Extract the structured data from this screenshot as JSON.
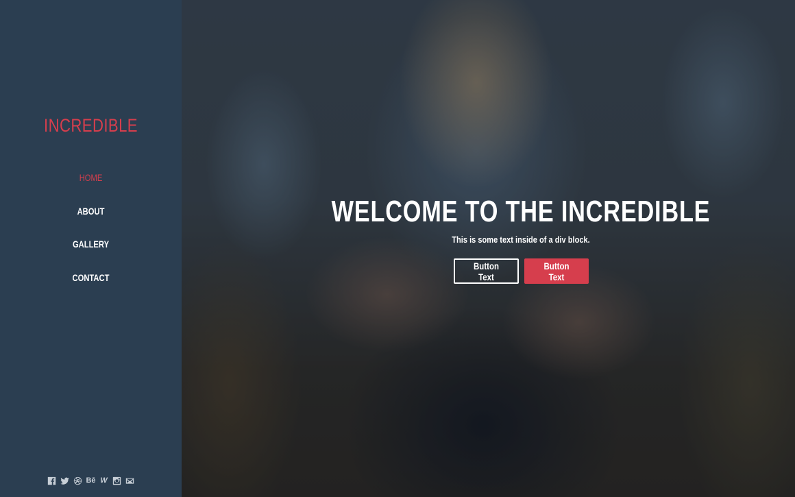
{
  "sidebar": {
    "brand": "INCREDIBLE",
    "nav": [
      {
        "label": "HOME",
        "active": true
      },
      {
        "label": "ABOUT",
        "active": false
      },
      {
        "label": "GALLERY",
        "active": false
      },
      {
        "label": "CONTACT",
        "active": false
      }
    ],
    "social": [
      "facebook-icon",
      "twitter-icon",
      "dribbble-icon",
      "behance-icon",
      "webflow-icon",
      "instagram-icon",
      "email-icon"
    ],
    "social_text": {
      "behance": "Bē",
      "webflow": "W"
    }
  },
  "hero": {
    "title": "WELCOME TO THE INCREDIBLE",
    "subtitle": "This is some text inside of a div block.",
    "button_outline": "Button Text",
    "button_primary": "Button Text"
  },
  "colors": {
    "accent": "#d63e4d",
    "sidebar_bg": "#2b3e51",
    "text": "#ffffff"
  }
}
